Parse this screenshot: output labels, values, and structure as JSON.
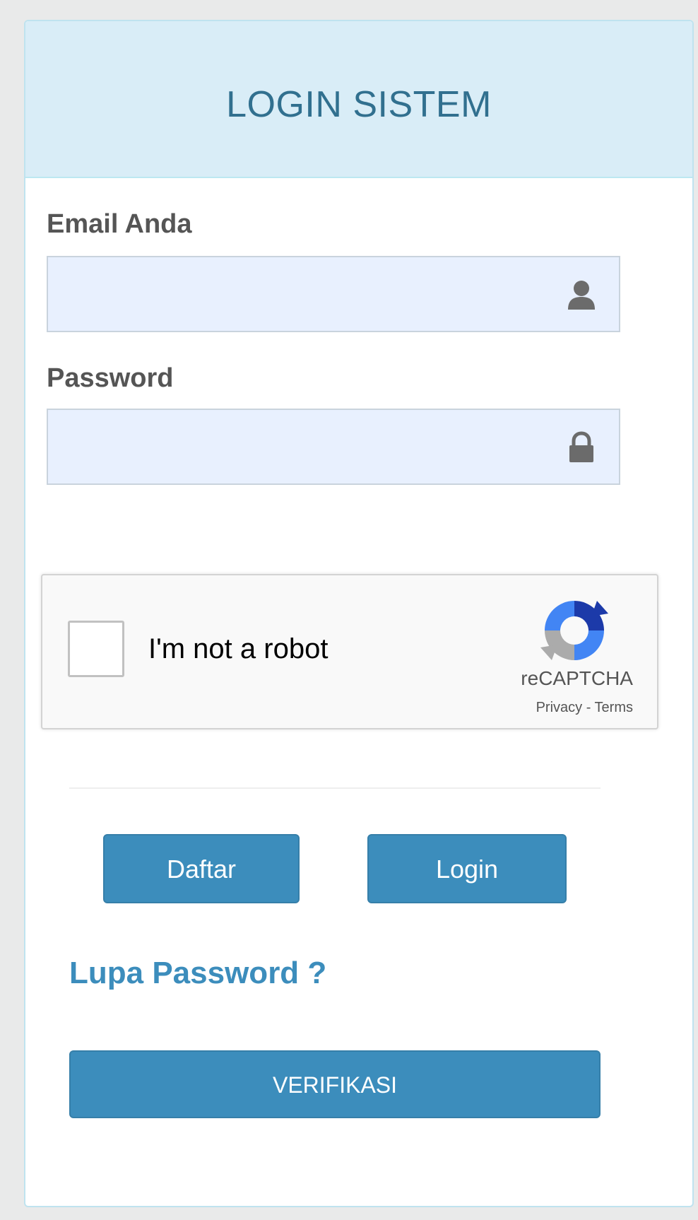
{
  "panel": {
    "title": "LOGIN SISTEM"
  },
  "form": {
    "email": {
      "label": "Email Anda",
      "value": "",
      "placeholder": "",
      "icon": "user-icon"
    },
    "password": {
      "label": "Password",
      "value": "",
      "placeholder": "",
      "icon": "lock-icon"
    }
  },
  "recaptcha": {
    "checkbox_label": "I'm not a robot",
    "brand": "reCAPTCHA",
    "links": "Privacy - Terms",
    "checked": false
  },
  "buttons": {
    "daftar": "Daftar",
    "login": "Login",
    "verifikasi": "VERIFIKASI"
  },
  "links": {
    "forgot_password": "Lupa Password ?"
  },
  "colors": {
    "primary": "#3c8dbc",
    "heading_bg": "#d9edf7",
    "heading_text": "#31708f",
    "input_bg": "#e8f0fe"
  }
}
